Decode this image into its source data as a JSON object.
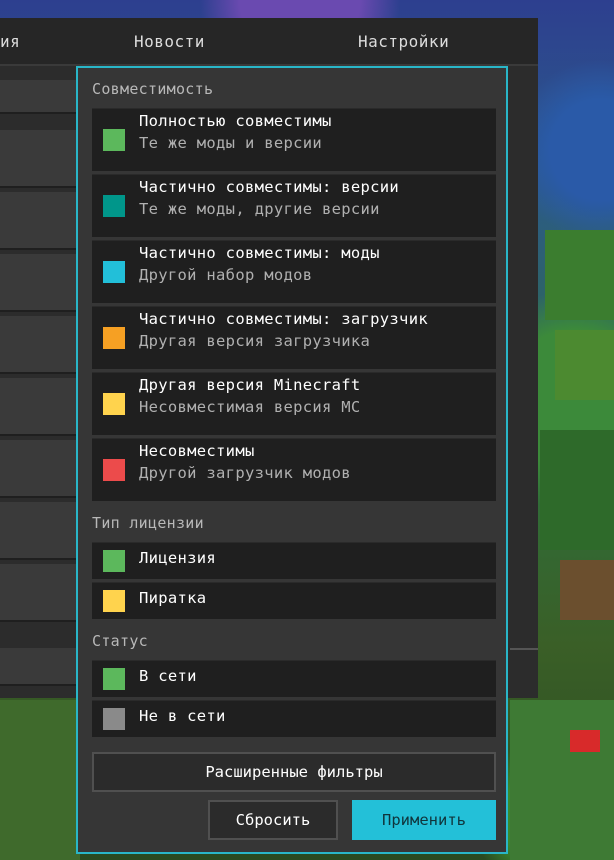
{
  "topbar": {
    "tabs": [
      "ия",
      "Новости",
      "Настройки"
    ]
  },
  "popup": {
    "compat_title": "Совместимость",
    "compat_items": [
      {
        "title": "Полностью совместимы",
        "subtitle": "Те же моды и версии",
        "color": "#5cb85c"
      },
      {
        "title": "Частично совместимы: версии",
        "subtitle": "Те же моды, другие версии",
        "color": "#00968a"
      },
      {
        "title": "Частично совместимы: моды",
        "subtitle": "Другой набор модов",
        "color": "#22bfd9"
      },
      {
        "title": "Частично совместимы: загрузчик",
        "subtitle": "Другая версия загрузчика",
        "color": "#f6a023"
      },
      {
        "title": "Другая версия Minecraft",
        "subtitle": "Несовместимая версия MC",
        "color": "#ffd34d"
      },
      {
        "title": "Несовместимы",
        "subtitle": "Другой загрузчик модов",
        "color": "#ec4b4b"
      }
    ],
    "license_title": "Тип лицензии",
    "license_items": [
      {
        "label": "Лицензия",
        "color": "#5cb85c"
      },
      {
        "label": "Пиратка",
        "color": "#ffd34d"
      }
    ],
    "status_title": "Статус",
    "status_items": [
      {
        "label": "В сети",
        "color": "#5cb85c"
      },
      {
        "label": "Не в сети",
        "color": "#8a8a8a"
      }
    ],
    "advanced_label": "Расширенные фильтры",
    "reset_label": "Сбросить",
    "apply_label": "Применить"
  }
}
